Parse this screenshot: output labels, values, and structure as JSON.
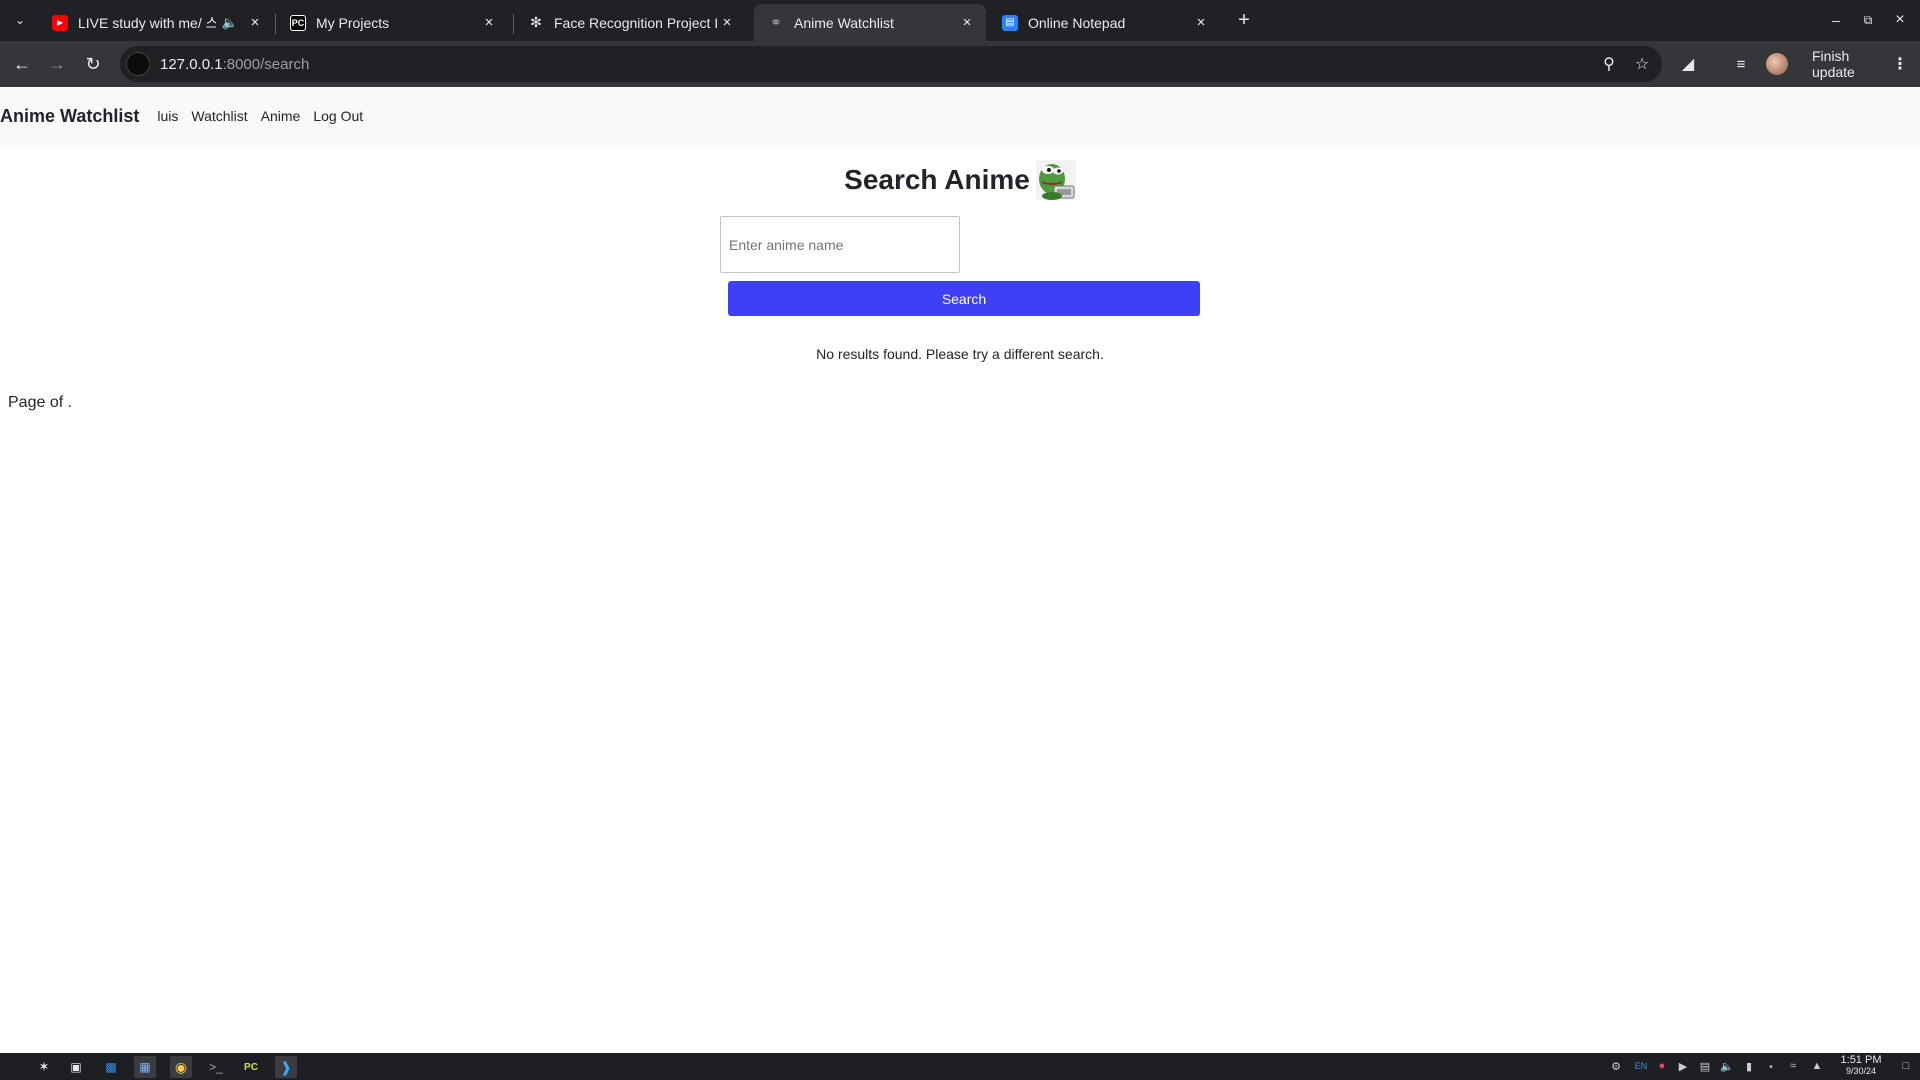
{
  "browser": {
    "tabs": [
      {
        "title": "LIVE study with me/ 스터",
        "favicon": "youtube-icon",
        "active": false,
        "audible": true
      },
      {
        "title": "My Projects",
        "favicon": "pycharm-icon",
        "active": false
      },
      {
        "title": "Face Recognition Project Id",
        "favicon": "chatgpt-icon",
        "active": false
      },
      {
        "title": "Anime Watchlist",
        "favicon": "globe-icon",
        "active": true
      },
      {
        "title": "Online Notepad",
        "favicon": "notepad-icon",
        "active": false
      }
    ],
    "url_host": "127.0.0.1",
    "url_path": ":8000/search",
    "finish_update_label": "Finish update"
  },
  "navbar": {
    "brand": "Anime Watchlist",
    "links": [
      "luis",
      "Watchlist",
      "Anime",
      "Log Out"
    ]
  },
  "search": {
    "heading": "Search Anime",
    "placeholder": "Enter anime name",
    "button_label": "Search",
    "no_results": "No results found. Please try a different search.",
    "pagination": "Page of ."
  },
  "taskbar": {
    "apps": [
      "launcher-icon",
      "workspace-icon",
      "files-icon",
      "installer-icon",
      "chrome-icon",
      "terminal-icon",
      "pycharm-icon",
      "vscode-icon"
    ],
    "tray_lang": "EN",
    "time": "1:51 PM",
    "date": "9/30/24"
  },
  "colors": {
    "primary_button": "#3f3ff5",
    "tab_strip": "#202124",
    "toolbar": "#35363a",
    "navbar_bg": "#f8f9fa"
  }
}
